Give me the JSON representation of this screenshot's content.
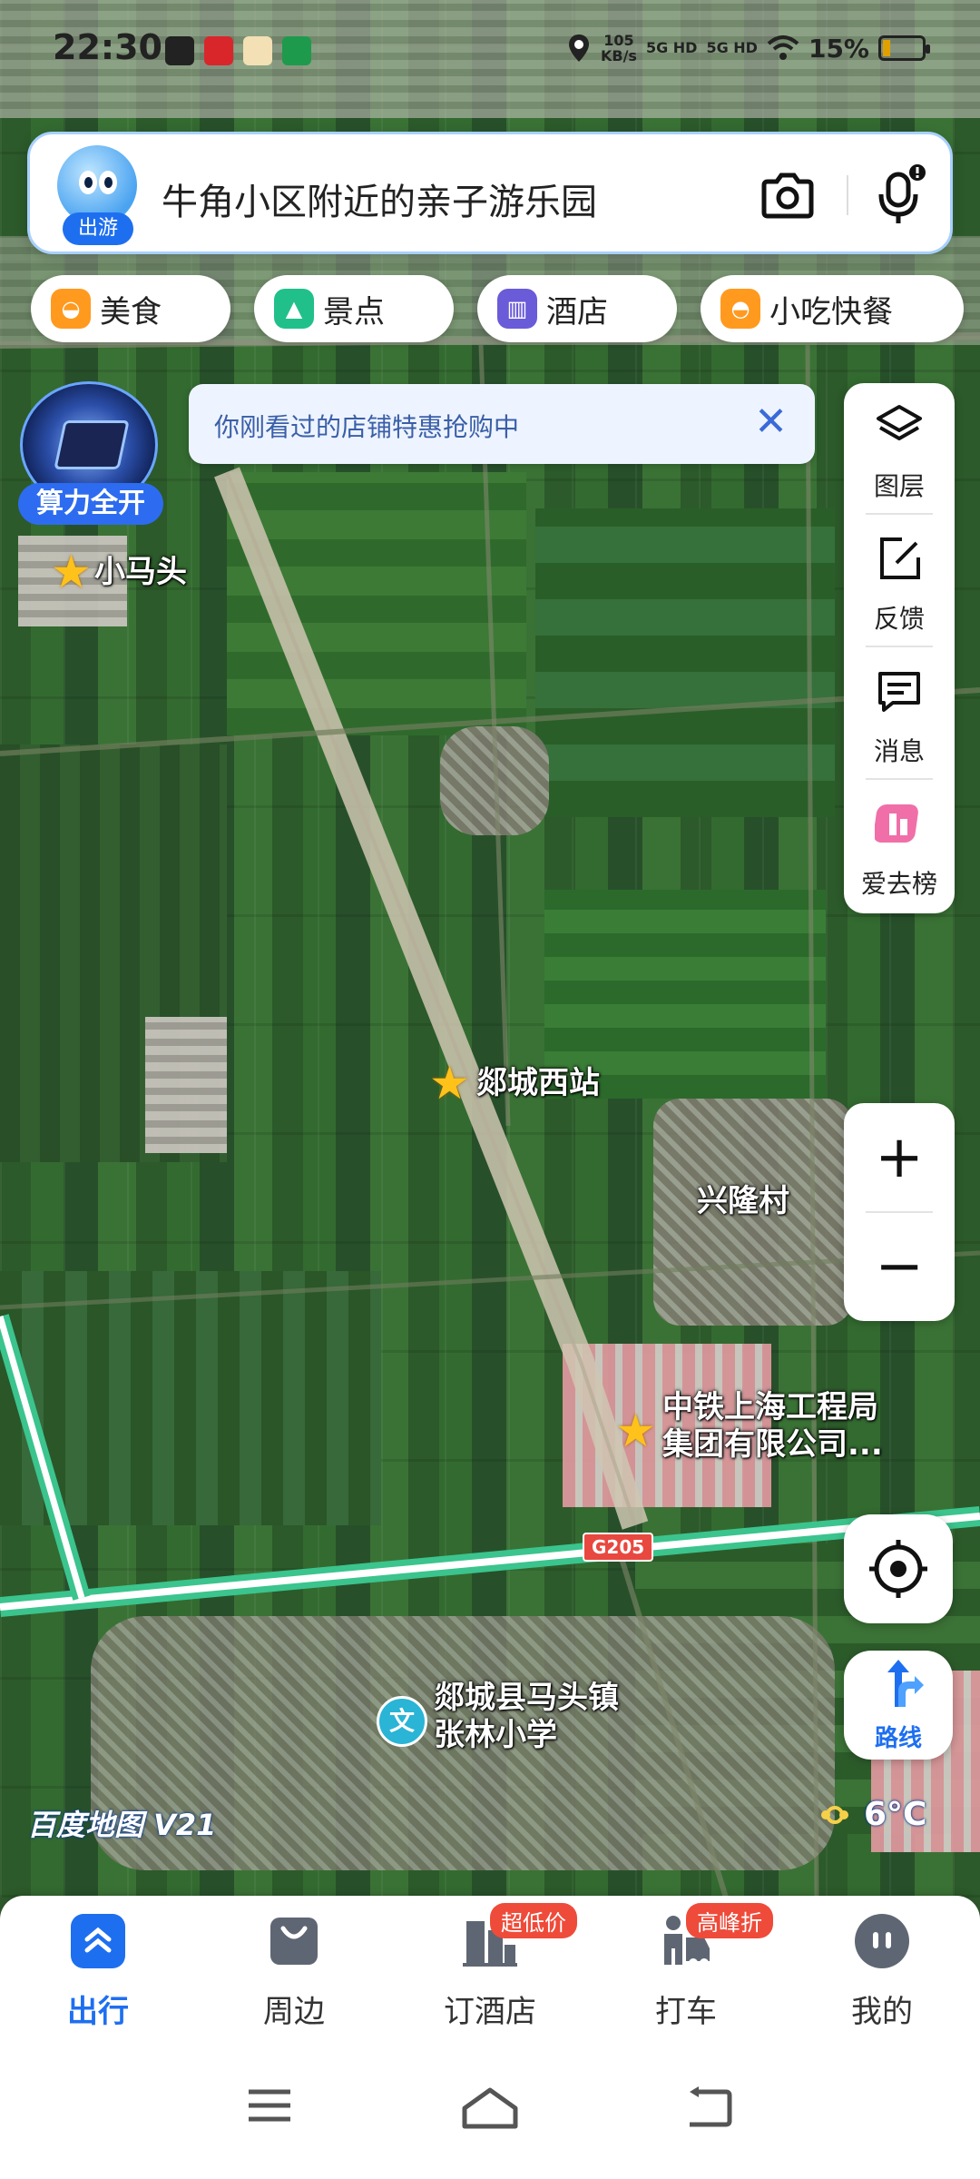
{
  "status_bar": {
    "time": "22:30",
    "net_speed_value": "105",
    "net_speed_unit": "KB/s",
    "signal1": "5G HD",
    "signal2": "5G HD",
    "battery": "15%"
  },
  "search": {
    "avatar_tag": "出游",
    "query": "牛角小区附近的亲子游乐园"
  },
  "categories": [
    {
      "label": "美食",
      "color": "#ff9a1f"
    },
    {
      "label": "景点",
      "color": "#21c08b"
    },
    {
      "label": "酒店",
      "color": "#6a5bd8"
    },
    {
      "label": "小吃快餐",
      "color": "#ff9a1f"
    }
  ],
  "notice": {
    "text": "你刚看过的店铺特惠抢购中"
  },
  "power_badge": {
    "label": "算力全开"
  },
  "tools": [
    {
      "label": "图层",
      "icon": "layers-icon"
    },
    {
      "label": "反馈",
      "icon": "feedback-icon"
    },
    {
      "label": "消息",
      "icon": "message-icon"
    },
    {
      "label": "爱去榜",
      "icon": "ranking-icon"
    }
  ],
  "zoom": {
    "in": "+",
    "out": "−"
  },
  "map": {
    "labels": {
      "xiaomatou": "小马头",
      "tancheng_west": "郯城西站",
      "xinglong": "兴隆村",
      "crec_line1": "中铁上海工程局",
      "crec_line2": "集团有限公司...",
      "school_line1": "郯城县马头镇",
      "school_line2": "张林小学",
      "road": "G205",
      "school_icon_text": "文"
    },
    "logo": "百度地图 V21",
    "weather": "6°C"
  },
  "route": {
    "label": "路线"
  },
  "tabs": [
    {
      "label": "出行",
      "active": true
    },
    {
      "label": "周边"
    },
    {
      "label": "订酒店",
      "badge": "超低价"
    },
    {
      "label": "打车",
      "badge": "高峰折"
    },
    {
      "label": "我的"
    }
  ],
  "colors": {
    "accent": "#1e6ff0",
    "badge_red": "#ef4b3a",
    "star": "#ffc21a",
    "highway_green": "#3bc48d"
  }
}
